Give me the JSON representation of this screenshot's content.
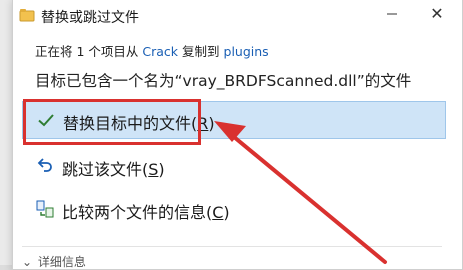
{
  "dialog": {
    "title": "替换或跳过文件",
    "progress": {
      "prefix": "正在将 1 个项目从",
      "source": "Crack",
      "middle": "复制到",
      "dest": "plugins"
    },
    "headline": "目标已包含一个名为“vray_BRDFScanned.dll”的文件",
    "options": {
      "replace": {
        "label": "替换目标中的文件(",
        "key": "R",
        "tail": ")"
      },
      "skip": {
        "label": "跳过该文件(",
        "key": "S",
        "tail": ")"
      },
      "compare": {
        "label": "比较两个文件的信息(",
        "key": "C",
        "tail": ")"
      }
    },
    "details": "详细信息"
  },
  "icons": {
    "title": "folder-copy-icon",
    "minimize": "minimize-icon",
    "close": "close-icon",
    "replace": "checkmark-icon",
    "skip": "undo-arrow-icon",
    "compare": "compare-files-icon",
    "details": "chevron-down-icon"
  },
  "colors": {
    "accent": "#1a5fb4",
    "selected_bg": "#cfe4f7",
    "highlight_red": "#d9312f"
  }
}
